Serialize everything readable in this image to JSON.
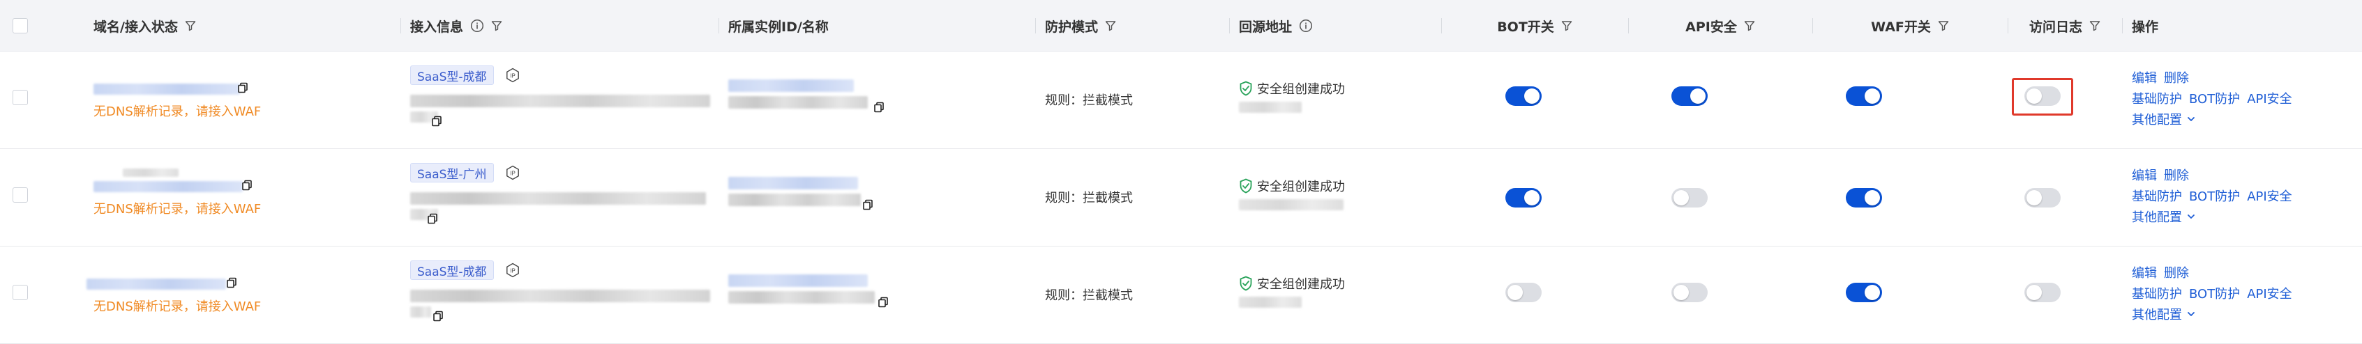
{
  "header": {
    "domain_status": "域名/接入状态",
    "access_info": "接入信息",
    "instance": "所属实例ID/名称",
    "protection_mode": "防护模式",
    "origin_address": "回源地址",
    "bot_switch": "BOT开关",
    "api_security": "API安全",
    "waf_switch": "WAF开关",
    "access_log": "访问日志",
    "actions": "操作"
  },
  "rows": [
    {
      "warning": "无DNS解析记录，请接入WAF",
      "tag": "SaaS型-成都",
      "mode": "规则：拦截模式",
      "origin_status": "安全组创建成功",
      "bot": true,
      "api": true,
      "waf": true,
      "log": false,
      "actions": {
        "edit": "编辑",
        "delete": "删除",
        "basic": "基础防护",
        "bot": "BOT防护",
        "api": "API安全",
        "more": "其他配置"
      }
    },
    {
      "warning": "无DNS解析记录，请接入WAF",
      "tag": "SaaS型-广州",
      "mode": "规则：拦截模式",
      "origin_status": "安全组创建成功",
      "bot": true,
      "api": false,
      "waf": true,
      "log": false,
      "actions": {
        "edit": "编辑",
        "delete": "删除",
        "basic": "基础防护",
        "bot": "BOT防护",
        "api": "API安全",
        "more": "其他配置"
      }
    },
    {
      "warning": "无DNS解析记录，请接入WAF",
      "tag": "SaaS型-成都",
      "mode": "规则：拦截模式",
      "origin_status": "安全组创建成功",
      "bot": false,
      "api": false,
      "waf": true,
      "log": false,
      "actions": {
        "edit": "编辑",
        "delete": "删除",
        "basic": "基础防护",
        "bot": "BOT防护",
        "api": "API安全",
        "more": "其他配置"
      }
    }
  ],
  "colors": {
    "accent": "#0a52d6",
    "link": "#1f5ed6",
    "warning": "#f08a24",
    "success": "#29a35a",
    "highlight": "#e0392b"
  },
  "icons": [
    "filter-icon",
    "info-icon",
    "copy-icon",
    "ip-icon",
    "shield-check-icon",
    "chevron-down-icon"
  ]
}
